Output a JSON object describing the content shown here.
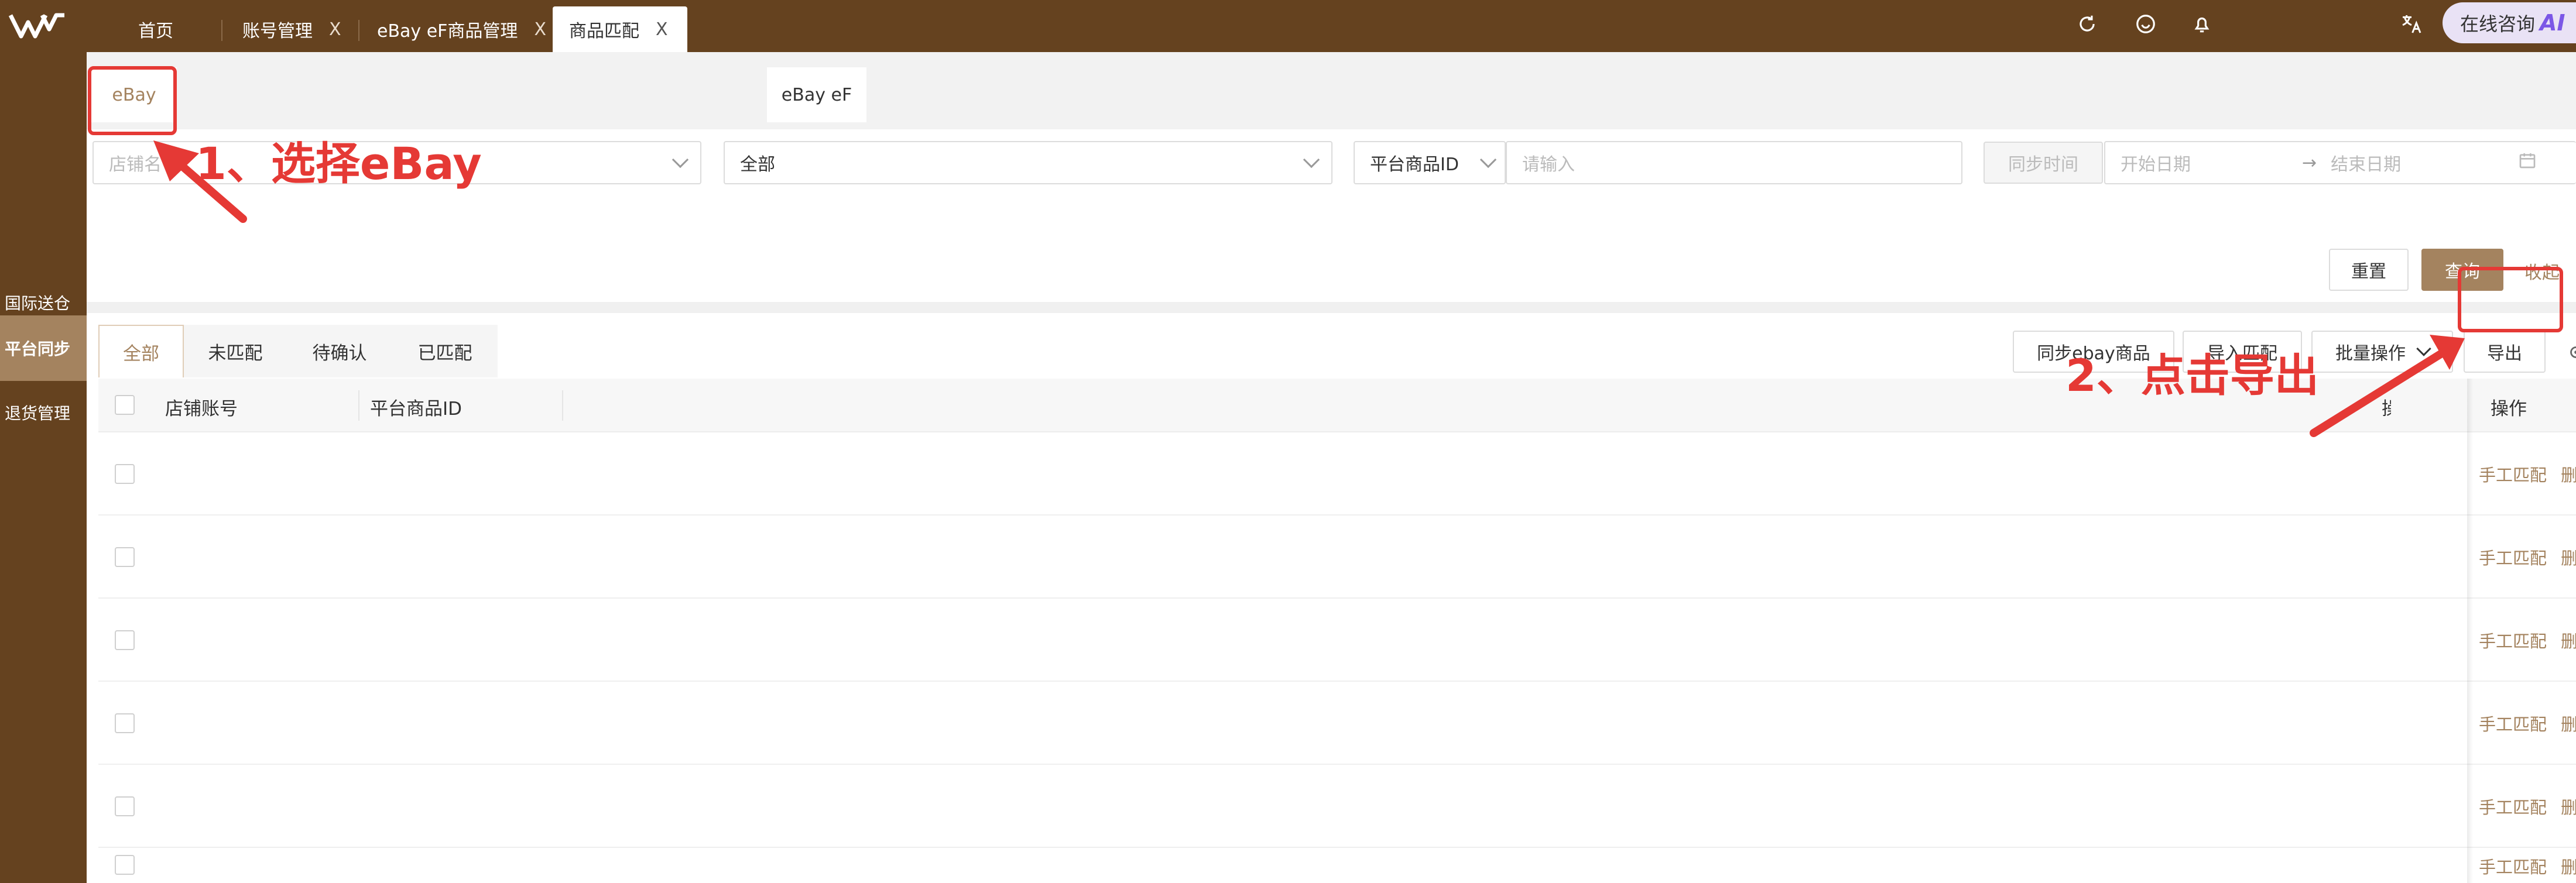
{
  "app": {
    "tabs": [
      {
        "label": "首页",
        "closable": false
      },
      {
        "label": "账号管理",
        "closable": true
      },
      {
        "label": "eBay eF商品管理",
        "closable": true
      },
      {
        "label": "商品匹配",
        "closable": true,
        "active": true
      }
    ],
    "close_glyph": "X",
    "top_icons": [
      "refresh-icon",
      "smile-icon",
      "bell-icon",
      "translate-icon"
    ],
    "consult_label": "在线咨询",
    "ai_label": "AI"
  },
  "sidebar": {
    "items": [
      {
        "label": "国际送仓",
        "active": false
      },
      {
        "label": "平台同步",
        "active": true
      },
      {
        "label": "退货管理",
        "active": false
      }
    ]
  },
  "platform_tabs": [
    {
      "label": "eBay",
      "active": true
    },
    {
      "label": "eBay eF",
      "active": false
    }
  ],
  "filters": {
    "store_placeholder": "店铺名",
    "status_value": "全部",
    "id_type_value": "平台商品ID",
    "id_placeholder": "请输入",
    "sync_time_label": "同步时间",
    "start_date_placeholder": "开始日期",
    "range_arrow": "→",
    "end_date_placeholder": "结束日期",
    "reset_label": "重置",
    "query_label": "查询",
    "collapse_label": "收起"
  },
  "status_tabs": [
    {
      "label": "全部",
      "active": true
    },
    {
      "label": "未匹配",
      "active": false
    },
    {
      "label": "待确认",
      "active": false
    },
    {
      "label": "已匹配",
      "active": false
    }
  ],
  "actions": {
    "sync_label": "同步ebay商品",
    "import_label": "导入匹配",
    "batch_label": "批量操作",
    "export_label": "导出"
  },
  "table": {
    "columns": [
      "店铺账号",
      "平台商品ID"
    ],
    "ops_column_label": "操作",
    "ops_column_partial": "操",
    "rows": [
      {
        "match_label": "手工匹配",
        "delete_label": "删除"
      },
      {
        "match_label": "手工匹配",
        "delete_label": "删除"
      },
      {
        "match_label": "手工匹配",
        "delete_label": "删除"
      },
      {
        "match_label": "手工匹配",
        "delete_label": "删除"
      },
      {
        "match_label": "手工匹配",
        "delete_label": "删除"
      },
      {
        "match_label": "手工匹配",
        "delete_label": "删除"
      }
    ]
  },
  "annotations": {
    "step1": "1、选择eBay",
    "step2": "2、点击导出",
    "color": "#e53935"
  },
  "colors": {
    "brand_dark": "#65421f",
    "brand_accent": "#a4835f"
  }
}
